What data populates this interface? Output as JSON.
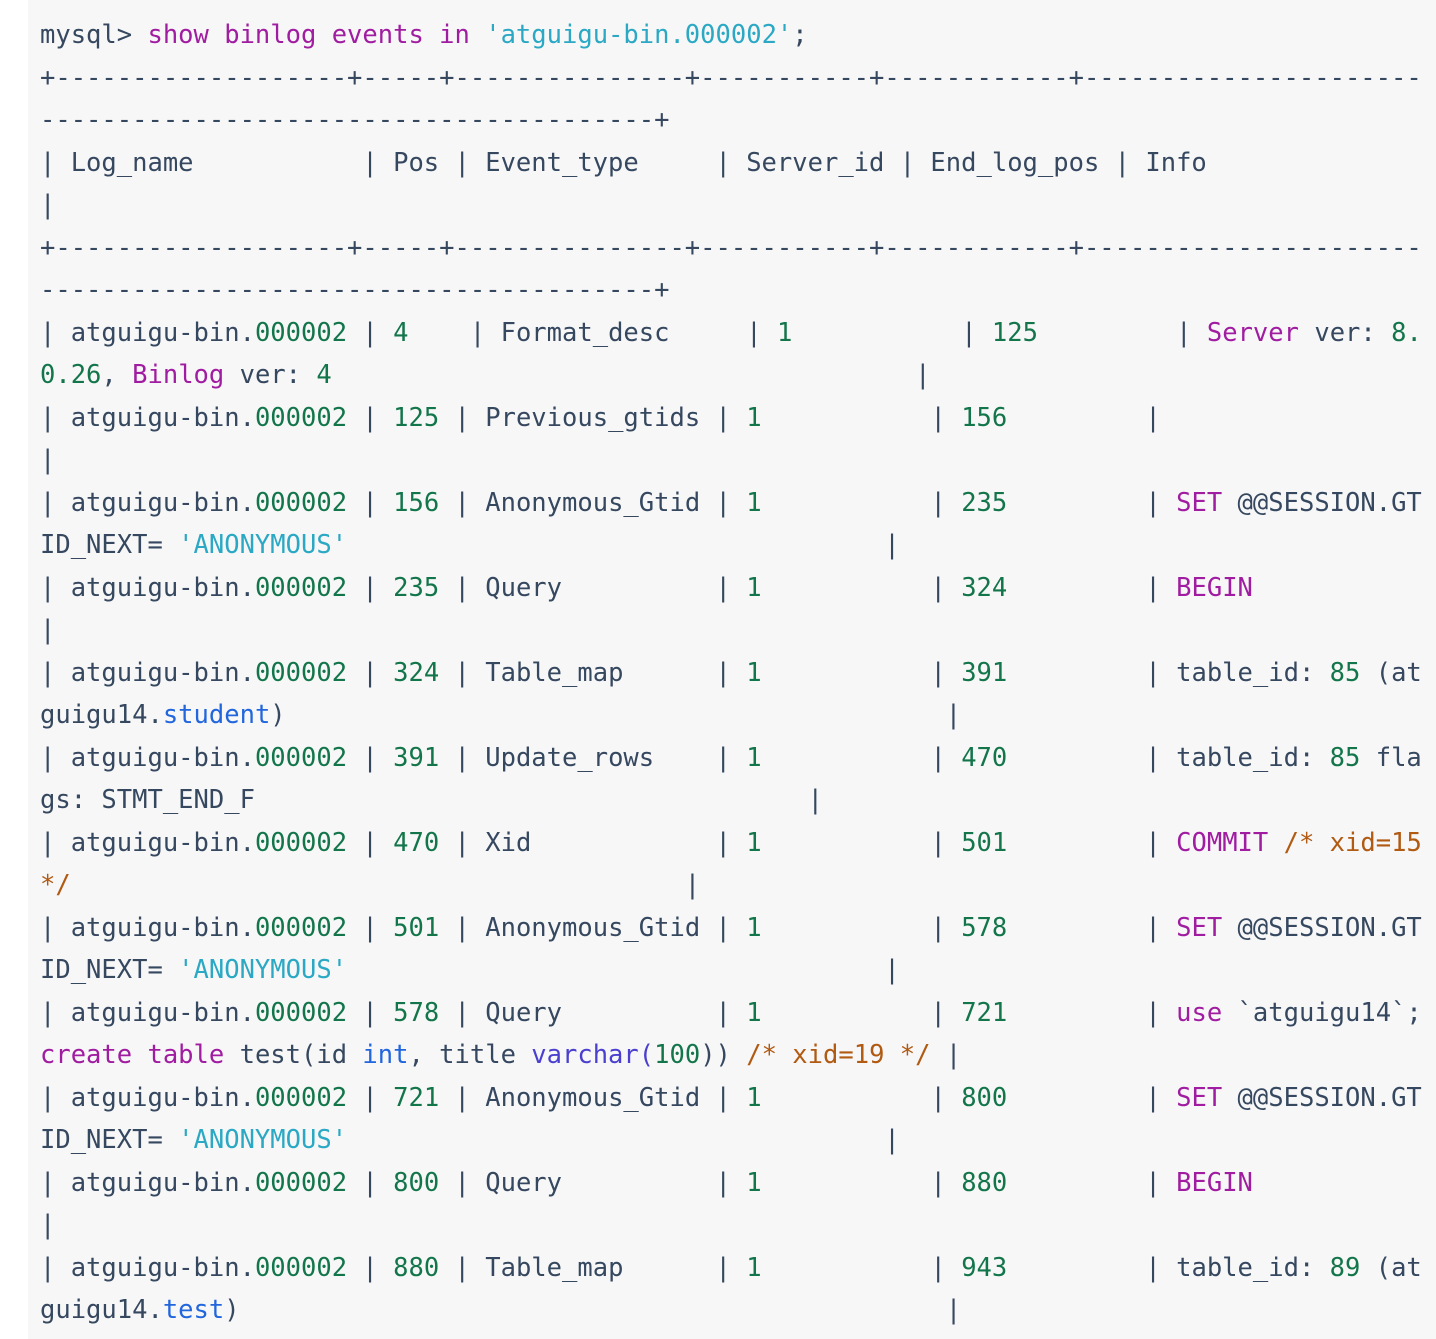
{
  "terminal": {
    "prompt": "mysql>",
    "command": {
      "keywords": "show binlog events in",
      "argument": "'atguigu-bin.000002';"
    },
    "separator_line": "+-------------------+-----+----------------+-----------+-------------+-----------------------------------------------------------------+",
    "columns": [
      "Log_name",
      "Pos",
      "Event_type",
      "Server_id",
      "End_log_pos",
      "Info"
    ],
    "header_row": "| Log_name          | Pos | Event_type     | Server_id | End_log_pos | Info                                                            |",
    "rows": [
      {
        "log_name": "atguigu-bin.000002",
        "pos": "4",
        "event_type": "Format_desc",
        "server_id": "1",
        "end_log_pos": "125",
        "info": "Server ver: 8.0.26, Binlog ver: 4"
      },
      {
        "log_name": "atguigu-bin.000002",
        "pos": "125",
        "event_type": "Previous_gtids",
        "server_id": "1",
        "end_log_pos": "156",
        "info": ""
      },
      {
        "log_name": "atguigu-bin.000002",
        "pos": "156",
        "event_type": "Anonymous_Gtid",
        "server_id": "1",
        "end_log_pos": "235",
        "info": "SET @@SESSION.GTID_NEXT= 'ANONYMOUS'"
      },
      {
        "log_name": "atguigu-bin.000002",
        "pos": "235",
        "event_type": "Query",
        "server_id": "1",
        "end_log_pos": "324",
        "info": "BEGIN"
      },
      {
        "log_name": "atguigu-bin.000002",
        "pos": "324",
        "event_type": "Table_map",
        "server_id": "1",
        "end_log_pos": "391",
        "info": "table_id: 85 (atguigu14.student)"
      },
      {
        "log_name": "atguigu-bin.000002",
        "pos": "391",
        "event_type": "Update_rows",
        "server_id": "1",
        "end_log_pos": "470",
        "info": "table_id: 85 flags: STMT_END_F"
      },
      {
        "log_name": "atguigu-bin.000002",
        "pos": "470",
        "event_type": "Xid",
        "server_id": "1",
        "end_log_pos": "501",
        "info": "COMMIT /* xid=15 */"
      },
      {
        "log_name": "atguigu-bin.000002",
        "pos": "501",
        "event_type": "Anonymous_Gtid",
        "server_id": "1",
        "end_log_pos": "578",
        "info": "SET @@SESSION.GTID_NEXT= 'ANONYMOUS'"
      },
      {
        "log_name": "atguigu-bin.000002",
        "pos": "578",
        "event_type": "Query",
        "server_id": "1",
        "end_log_pos": "721",
        "info": "use `atguigu14`; create table test(id int, title varchar(100)) /* xid=19 */"
      },
      {
        "log_name": "atguigu-bin.000002",
        "pos": "721",
        "event_type": "Anonymous_Gtid",
        "server_id": "1",
        "end_log_pos": "800",
        "info": "SET @@SESSION.GTID_NEXT= 'ANONYMOUS'"
      },
      {
        "log_name": "atguigu-bin.000002",
        "pos": "800",
        "event_type": "Query",
        "server_id": "1",
        "end_log_pos": "880",
        "info": "BEGIN"
      },
      {
        "log_name": "atguigu-bin.000002",
        "pos": "880",
        "event_type": "Table_map",
        "server_id": "1",
        "end_log_pos": "943",
        "info": "table_id: 89 (atguigu14.test)"
      }
    ]
  },
  "lines": {
    "l01_prompt": "mysql> ",
    "l01_kw": "show binlog events in",
    "l01_str": " 'atguigu-bin.000002'",
    "l01_end": ";",
    "l02_sep": "+-------------------+-----+---------------+-----------+------------+--------------------------------------------------------------+",
    "l03_header_a": "| Log_name           | Pos | Event_type     | Server_id | End_log_pos | Info",
    "l03_header_b": "                                                                        |",
    "l04_sep": "+-------------------+-----+---------------+-----------+------------+--------------------------------------------------------------+",
    "r1_a": "| atguigu-bin.",
    "r1_num1": "000002",
    "r1_b": " | ",
    "r1_pos": "4",
    "r1_c": "    | Format_desc     | ",
    "r1_sid": "1",
    "r1_d": "           | ",
    "r1_elp": "125",
    "r1_e": "         | ",
    "r1_kw": "Server",
    "r1_f": " ver: ",
    "r1_ver": "8.0.26",
    "r1_g": ", ",
    "r1_kw2": "Binlog",
    "r1_h": " ver: ",
    "r1_ver2": "4",
    "r1_tail": "                                      |",
    "r2_a": "| atguigu-bin.",
    "r2_num1": "000002",
    "r2_b": " | ",
    "r2_pos": "125",
    "r2_c": " | Previous_gtids | ",
    "r2_sid": "1",
    "r2_d": "           | ",
    "r2_elp": "156",
    "r2_e": "         |",
    "r2_tail": "                                                      |",
    "r3_a": "| atguigu-bin.",
    "r3_num1": "000002",
    "r3_b": " | ",
    "r3_pos": "156",
    "r3_c": " | Anonymous_Gtid | ",
    "r3_sid": "1",
    "r3_d": "           | ",
    "r3_elp": "235",
    "r3_e": "         | ",
    "r3_kw": "SET",
    "r3_f": " @@SESSION.GTID_NEXT= ",
    "r3_str": "'ANONYMOUS'",
    "r3_tail": "                                   |",
    "r4_a": "| atguigu-bin.",
    "r4_num1": "000002",
    "r4_b": " | ",
    "r4_pos": "235",
    "r4_c": " | Query          | ",
    "r4_sid": "1",
    "r4_d": "           | ",
    "r4_elp": "324",
    "r4_e": "         | ",
    "r4_kw": "BEGIN",
    "r4_tail": "                                                        |",
    "r5_a": "| atguigu-bin.",
    "r5_num1": "000002",
    "r5_b": " | ",
    "r5_pos": "324",
    "r5_c": " | Table_map      | ",
    "r5_sid": "1",
    "r5_d": "           | ",
    "r5_elp": "391",
    "r5_e": "         | table_id: ",
    "r5_tid": "85",
    "r5_f": " (atguigu14.",
    "r5_ident": "student",
    "r5_g": ")",
    "r5_tail": "                                           |",
    "r6_a": "| atguigu-bin.",
    "r6_num1": "000002",
    "r6_b": " | ",
    "r6_pos": "391",
    "r6_c": " | Update_rows    | ",
    "r6_sid": "1",
    "r6_d": "           | ",
    "r6_elp": "470",
    "r6_e": "         | table_id: ",
    "r6_tid": "85",
    "r6_f": " flags: STMT_END_F",
    "r6_tail": "                                    |",
    "r7_a": "| atguigu-bin.",
    "r7_num1": "000002",
    "r7_b": " | ",
    "r7_pos": "470",
    "r7_c": " | Xid            | ",
    "r7_sid": "1",
    "r7_d": "           | ",
    "r7_elp": "501",
    "r7_e": "         | ",
    "r7_kw": "COMMIT",
    "r7_f": " ",
    "r7_cmt": "/* xid=15 */",
    "r7_tail": "                                        |",
    "r8_a": "| atguigu-bin.",
    "r8_num1": "000002",
    "r8_b": " | ",
    "r8_pos": "501",
    "r8_c": " | Anonymous_Gtid | ",
    "r8_sid": "1",
    "r8_d": "           | ",
    "r8_elp": "578",
    "r8_e": "         | ",
    "r8_kw": "SET",
    "r8_f": " @@SESSION.GTID_NEXT= ",
    "r8_str": "'ANONYMOUS'",
    "r8_tail": "                                   |",
    "r9_a": "| atguigu-bin.",
    "r9_num1": "000002",
    "r9_b": " | ",
    "r9_pos": "578",
    "r9_c": " | Query          | ",
    "r9_sid": "1",
    "r9_d": "           | ",
    "r9_elp": "721",
    "r9_e": "         | ",
    "r9_kw": "use",
    "r9_f": " `atguigu14`; ",
    "r9_kw2": "create table",
    "r9_g": " test(id ",
    "r9_type1": "int",
    "r9_h": ", title ",
    "r9_type2": "varchar",
    "r9_i": "(",
    "r9_n100": "100",
    "r9_j": ")) ",
    "r9_cmt": "/* xid=19 */",
    "r9_tail": " |",
    "r10_a": "| atguigu-bin.",
    "r10_num1": "000002",
    "r10_b": " | ",
    "r10_pos": "721",
    "r10_c": " | Anonymous_Gtid | ",
    "r10_sid": "1",
    "r10_d": "           | ",
    "r10_elp": "800",
    "r10_e": "         | ",
    "r10_kw": "SET",
    "r10_f": " @@SESSION.GTID_NEXT= ",
    "r10_str": "'ANONYMOUS'",
    "r10_tail": "                                   |",
    "r11_a": "| atguigu-bin.",
    "r11_num1": "000002",
    "r11_b": " | ",
    "r11_pos": "800",
    "r11_c": " | Query          | ",
    "r11_sid": "1",
    "r11_d": "           | ",
    "r11_elp": "880",
    "r11_e": "         | ",
    "r11_kw": "BEGIN",
    "r11_tail": "                                                        |",
    "r12_a": "| atguigu-bin.",
    "r12_num1": "000002",
    "r12_b": " | ",
    "r12_pos": "880",
    "r12_c": " | Table_map      | ",
    "r12_sid": "1",
    "r12_d": "           | ",
    "r12_elp": "943",
    "r12_e": "         | table_id: ",
    "r12_tid": "89",
    "r12_f": " (atguigu14.",
    "r12_ident": "test",
    "r12_g": ")",
    "r12_tail": "                                              |"
  }
}
